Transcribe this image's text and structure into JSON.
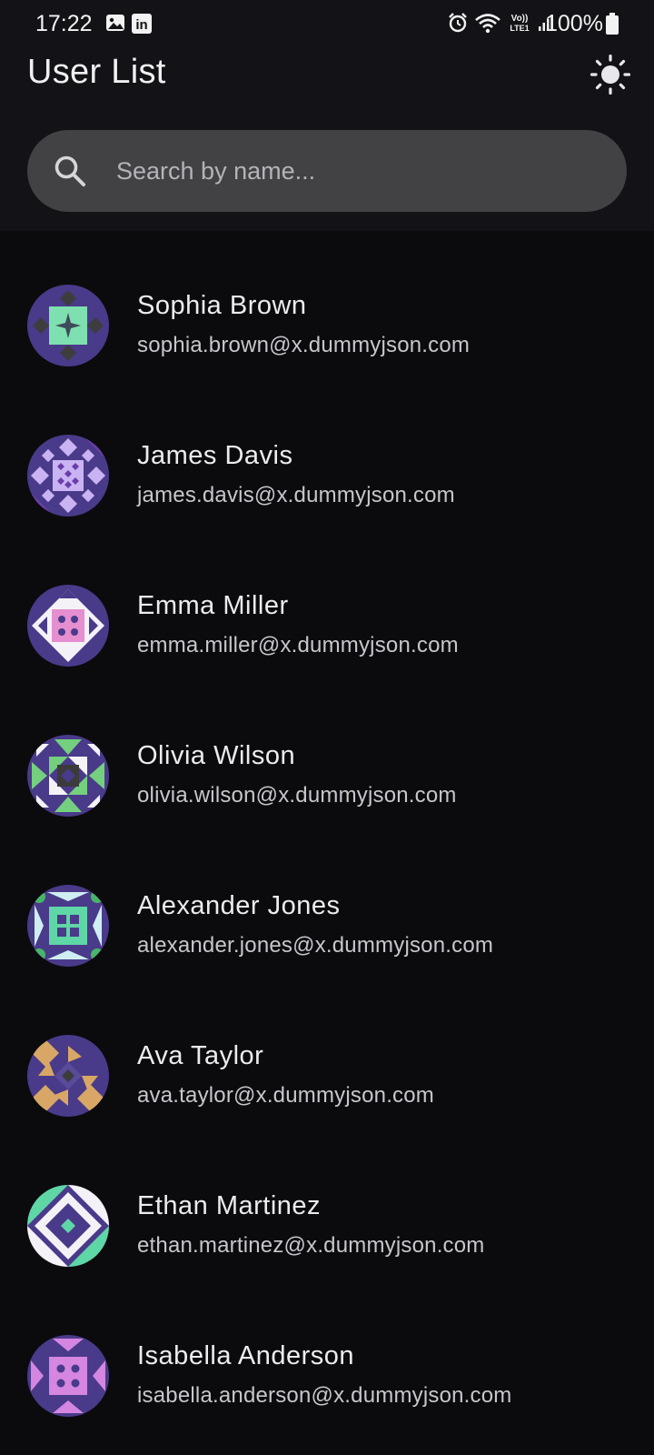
{
  "status_bar": {
    "time": "17:22",
    "battery": "100%",
    "icons": [
      "gallery-icon",
      "linkedin-icon",
      "alarm-icon",
      "wifi-icon",
      "volte-icon",
      "signal-icon",
      "battery-icon"
    ],
    "network_label_top": "Vo))",
    "network_label_bottom": "LTE1",
    "linkedin_glyph": "in"
  },
  "header": {
    "title": "User List",
    "theme_toggle_icon": "sun-icon"
  },
  "search": {
    "placeholder": "Search by name...",
    "value": ""
  },
  "users": [
    {
      "name": "Sophia Brown",
      "email": "sophia.brown@x.dummyjson.com",
      "avatar_accent": "#7ee0b0"
    },
    {
      "name": "James Davis",
      "email": "james.davis@x.dummyjson.com",
      "avatar_accent": "#c9b3f2"
    },
    {
      "name": "Emma Miller",
      "email": "emma.miller@x.dummyjson.com",
      "avatar_accent": "#e58fd0"
    },
    {
      "name": "Olivia Wilson",
      "email": "olivia.wilson@x.dummyjson.com",
      "avatar_accent": "#74d07e"
    },
    {
      "name": "Alexander Jones",
      "email": "alexander.jones@x.dummyjson.com",
      "avatar_accent": "#5fd6a6"
    },
    {
      "name": "Ava Taylor",
      "email": "ava.taylor@x.dummyjson.com",
      "avatar_accent": "#d9a765"
    },
    {
      "name": "Ethan Martinez",
      "email": "ethan.martinez@x.dummyjson.com",
      "avatar_accent": "#5fd6a6"
    },
    {
      "name": "Isabella Anderson",
      "email": "isabella.anderson@x.dummyjson.com",
      "avatar_accent": "#d486e0"
    }
  ],
  "colors": {
    "background": "#0b0b0d",
    "app_bar": "#121217",
    "search_field": "#424245",
    "avatar_base": "#4a3a8a"
  }
}
